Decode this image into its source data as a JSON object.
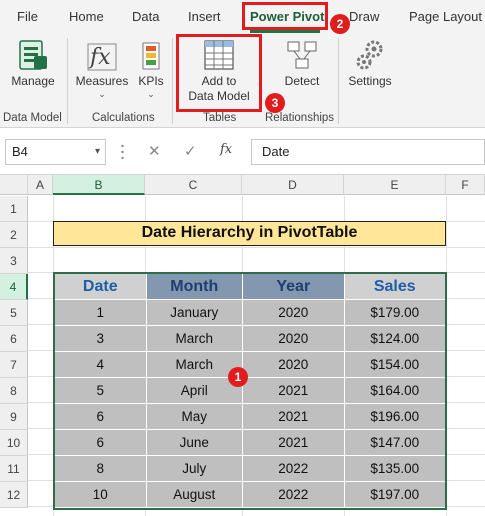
{
  "ribbon_tabs": [
    "File",
    "Home",
    "Data",
    "Insert",
    "Power Pivot",
    "Draw",
    "Page Layout"
  ],
  "active_tab": "Power Pivot",
  "ribbon": {
    "manage": "Manage",
    "measures": "Measures",
    "kpis": "KPIs",
    "add_line1": "Add to",
    "add_line2": "Data Model",
    "detect": "Detect",
    "settings": "Settings",
    "groups": {
      "data_model": "Data Model",
      "calculations": "Calculations",
      "tables": "Tables",
      "relationships": "Relationships"
    }
  },
  "badges": {
    "one": "1",
    "two": "2",
    "three": "3"
  },
  "formula_bar": {
    "name_box": "B4",
    "fx": "fx",
    "value": "Date"
  },
  "columns": [
    "A",
    "B",
    "C",
    "D",
    "E",
    "F"
  ],
  "rows": [
    "1",
    "2",
    "3",
    "4",
    "5",
    "6",
    "7",
    "8",
    "9",
    "10",
    "11",
    "12"
  ],
  "sheet": {
    "title": "Date Hierarchy in PivotTable",
    "headers": [
      "Date",
      "Month",
      "Year",
      "Sales"
    ],
    "data": [
      [
        "1",
        "January",
        "2020",
        "$179.00"
      ],
      [
        "3",
        "March",
        "2020",
        "$124.00"
      ],
      [
        "4",
        "March",
        "2020",
        "$154.00"
      ],
      [
        "5",
        "April",
        "2021",
        "$164.00"
      ],
      [
        "6",
        "May",
        "2021",
        "$196.00"
      ],
      [
        "6",
        "June",
        "2021",
        "$147.00"
      ],
      [
        "8",
        "July",
        "2022",
        "$135.00"
      ],
      [
        "10",
        "August",
        "2022",
        "$197.00"
      ]
    ]
  },
  "colors": {
    "accent_green": "#217346",
    "highlight_red": "#e11c1c",
    "title_fill": "#ffe699"
  }
}
